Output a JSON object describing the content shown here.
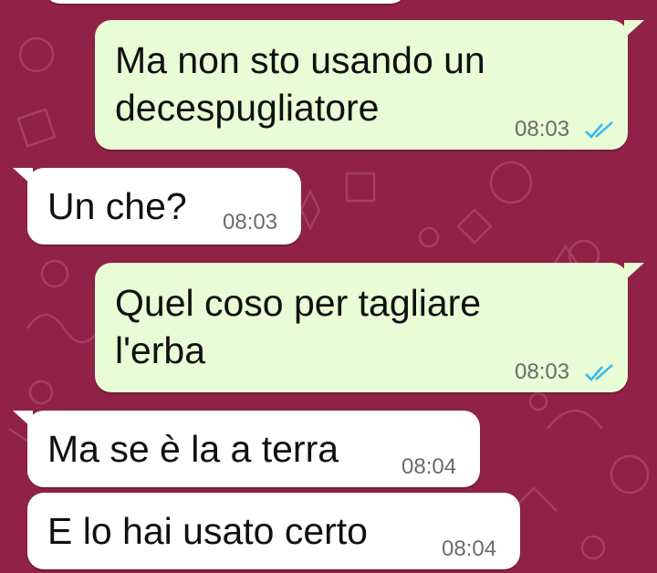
{
  "theme": {
    "wallpaper_color": "#8f2246",
    "outgoing_bubble_color": "#e8fcd6",
    "incoming_bubble_color": "#ffffff",
    "read_tick_color": "#34b7f1",
    "read_receipt_icon": "double-check-icon"
  },
  "messages": [
    {
      "direction": "outgoing",
      "text": "Ma non sto usando un\ndecespugliatore",
      "time": "08:03",
      "status": "read"
    },
    {
      "direction": "incoming",
      "text": "Un che?",
      "time": "08:03"
    },
    {
      "direction": "outgoing",
      "text": "Quel coso per tagliare\nl'erba",
      "time": "08:03",
      "status": "read"
    },
    {
      "direction": "incoming",
      "text": "Ma se è la a terra",
      "time": "08:04"
    },
    {
      "direction": "incoming",
      "text": "E lo hai usato certo",
      "time": "08:04"
    }
  ]
}
